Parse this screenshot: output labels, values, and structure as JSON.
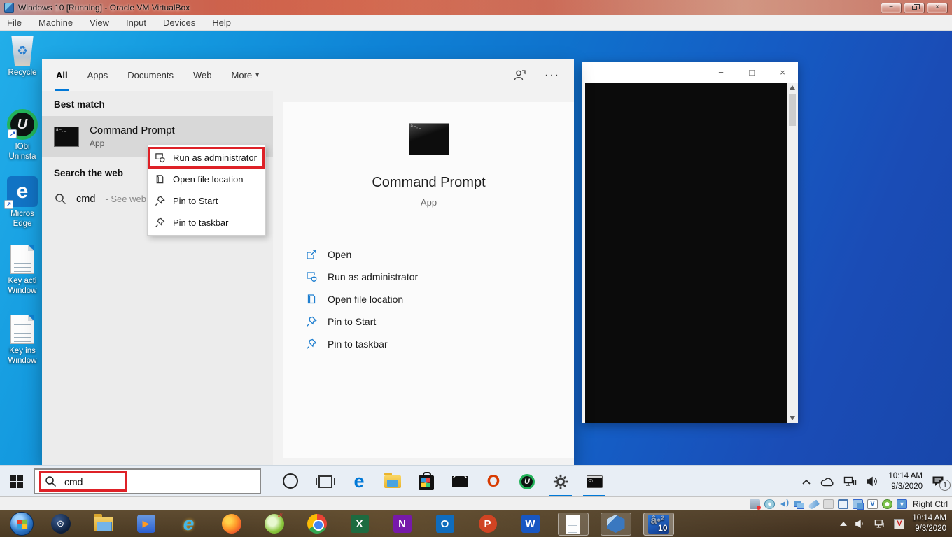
{
  "colors": {
    "accent_blue": "#0078d7",
    "annotation_red": "#de2127",
    "desktop_blue": "#0f7ad0",
    "action_icon_blue": "#1f7fd0"
  },
  "vbox_window": {
    "title": "Windows 10 [Running] - Oracle VM VirtualBox",
    "menu_items": [
      "File",
      "Machine",
      "View",
      "Input",
      "Devices",
      "Help"
    ]
  },
  "glyphs": {
    "minimize": "−",
    "maximize": "□",
    "close": "×",
    "more_caret": "▾",
    "ellipsis": "···",
    "recycle": "♻",
    "play": "▶",
    "steam": "⊙",
    "shortcut_arrow": "↗"
  },
  "desktop_icons": [
    {
      "name": "recycle-bin",
      "label_lines": [
        "Recycle",
        ""
      ]
    },
    {
      "name": "iobit-uninstaller-shortcut",
      "letter": "U",
      "label_lines": [
        "IObi",
        "Uninsta"
      ]
    },
    {
      "name": "microsoft-edge-shortcut",
      "letter": "e",
      "label_lines": [
        "Micros",
        "Edge"
      ]
    },
    {
      "name": "key-activation-document",
      "label_lines": [
        "Key acti",
        "Window"
      ]
    },
    {
      "name": "key-installation-document",
      "label_lines": [
        "Key ins",
        "Window"
      ]
    }
  ],
  "search_flyout": {
    "tabs": [
      "All",
      "Apps",
      "Documents",
      "Web",
      "More"
    ],
    "active_tab": "All",
    "header_icons": [
      "user-icon",
      "ellipsis-icon"
    ],
    "best_match_label": "Best match",
    "best_match": {
      "title": "Command Prompt",
      "type": "App"
    },
    "search_web_label": "Search the web",
    "web_suggestion": {
      "query": "cmd",
      "hint": "- See web resul"
    },
    "context_menu": {
      "items": [
        "Run as administrator",
        "Open file location",
        "Pin to Start",
        "Pin to taskbar"
      ],
      "highlighted_item": "Run as administrator"
    },
    "detail_panel": {
      "app_title": "Command Prompt",
      "app_type": "App",
      "actions": [
        "Open",
        "Run as administrator",
        "Open file location",
        "Pin to Start",
        "Pin to taskbar"
      ]
    }
  },
  "vm_taskbar": {
    "search_value": "cmd",
    "pinned_icons": [
      "start",
      "cortana",
      "task-view",
      "edge",
      "file-explorer",
      "microsoft-store",
      "mail",
      "office",
      "iobit-uninstaller",
      "settings",
      "command-prompt"
    ],
    "open_apps": [
      "settings",
      "command-prompt"
    ],
    "office_letter": "O",
    "iobit_letter": "U",
    "edge_letter": "e",
    "tray": {
      "time": "10:14 AM",
      "date": "9/3/2020",
      "notification_count": "1",
      "icons": [
        "chevron-up",
        "onedrive-cloud",
        "network",
        "speaker",
        "notifications"
      ]
    }
  },
  "vbox_status_bar": {
    "icons": [
      "hard-disk",
      "optical-disc",
      "audio",
      "network",
      "usb",
      "shared-folders",
      "display",
      "shared-clipboard",
      "machine-info",
      "mouse-integration",
      "keyboard"
    ],
    "keyboard_glyph": "▼",
    "vdoc_letter": "V",
    "host_key_label": "Right Ctrl"
  },
  "host_taskbar": {
    "icons": [
      "start-orb",
      "steam",
      "file-explorer",
      "media-player",
      "internet-explorer",
      "firefox",
      "green-app",
      "chrome",
      "excel",
      "onenote",
      "outlook",
      "powerpoint",
      "word",
      "notepad",
      "virtualbox",
      "windows10-vm"
    ],
    "excel_letter": "X",
    "onenote_letter": "N",
    "outlook_letter": "O",
    "powerpoint_letter": "P",
    "word_letter": "W",
    "ie_letter": "e",
    "vm_badge": "10",
    "vtray_letter": "V",
    "tray": {
      "time": "10:14 AM",
      "date": "9/3/2020",
      "icons": [
        "show-hidden",
        "speaker",
        "network",
        "virtualbox-tray"
      ]
    }
  }
}
